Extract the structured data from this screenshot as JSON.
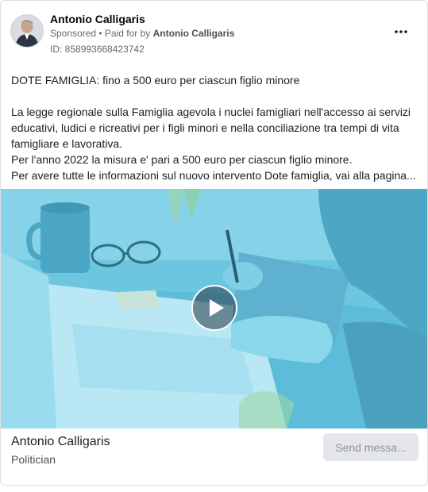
{
  "advertiser": {
    "name": "Antonio Calligaris",
    "sponsored_label": "Sponsored",
    "separator": " • ",
    "paid_for_prefix": "Paid for by ",
    "paid_for_name": "Antonio Calligaris",
    "ad_id": "ID: 858993668423742"
  },
  "post": {
    "headline": "DOTE FAMIGLIA: fino a 500 euro per ciascun figlio minore",
    "paragraph1": "La legge regionale sulla Famiglia agevola i nuclei famigliari nell'accesso ai servizi educativi, ludici e ricreativi per i figli minori e nella conciliazione tra tempi di vita famigliare e lavorativa.",
    "paragraph2": "Per l'anno 2022 la misura e' pari a 500 euro per ciascun figlio minore.",
    "paragraph3": "Per avere tutte le informazioni sul nuovo intervento Dote famiglia, vai alla pagina..."
  },
  "footer": {
    "title": "Antonio Calligaris",
    "subtitle": "Politician",
    "cta_label": "Send messa..."
  },
  "icons": {
    "more": "more-horizontal-icon",
    "play": "play-icon"
  },
  "colors": {
    "media_tint": "#66c3df",
    "cta_bg": "#e4e6eb",
    "cta_text": "#8d949e"
  }
}
